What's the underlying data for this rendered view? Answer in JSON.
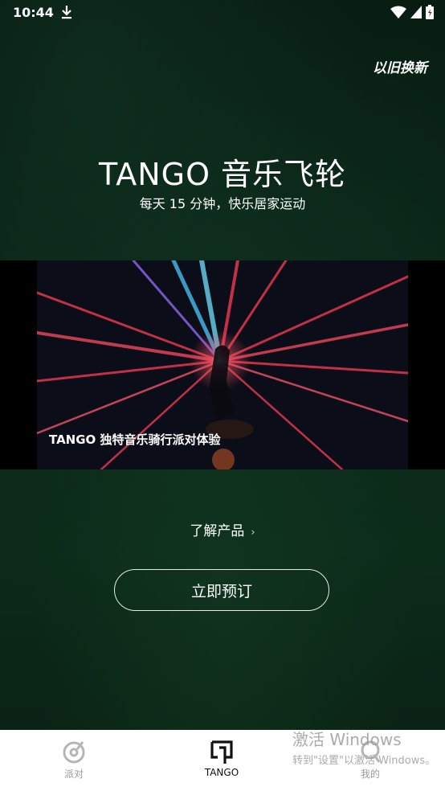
{
  "status_bar": {
    "time": "10:44",
    "icons": [
      "download-icon",
      "wifi-icon",
      "signal-icon",
      "battery-icon"
    ]
  },
  "header": {
    "trade_in_label": "以旧换新"
  },
  "hero": {
    "title": "TANGO 音乐飞轮",
    "subtitle": "每天 15 分钟，快乐居家运动"
  },
  "banner": {
    "caption": "TANGO 独特音乐骑行派对体验"
  },
  "actions": {
    "learn_more_label": "了解产品",
    "learn_more_chevron": "›",
    "order_label": "立即预订"
  },
  "tab_bar": {
    "tabs": [
      {
        "label": "派对",
        "icon": "party-icon",
        "active": false
      },
      {
        "label": "TANGO",
        "icon": "tango-icon",
        "active": true
      },
      {
        "label": "我的",
        "icon": "profile-icon",
        "active": false
      }
    ]
  },
  "watermark": {
    "line1": "激活 Windows",
    "line2": "转到\"设置\"以激活 Windows。"
  },
  "colors": {
    "background": "#0a2416",
    "tab_bar": "#ffffff",
    "active_tab": "#111111",
    "inactive_tab": "#9a9a9a"
  }
}
